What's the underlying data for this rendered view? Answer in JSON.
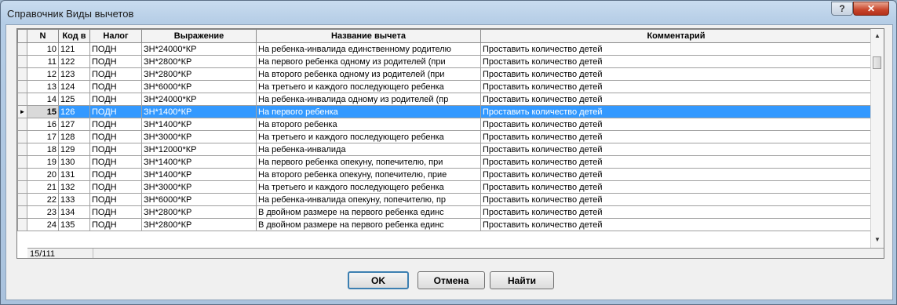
{
  "window": {
    "title": "Справочник Виды вычетов",
    "help_label": "?",
    "close_label": "✕"
  },
  "grid": {
    "columns": [
      "N",
      "Код в",
      "Налог",
      "Выражение",
      "Название вычета",
      "Комментарий"
    ],
    "rows": [
      {
        "n": "10",
        "code": "121",
        "tax": "ПОДН",
        "expr": "ЗН*24000*КР",
        "name": "На ребенка-инвалида единственному родителю",
        "comment": "Проставить количество детей"
      },
      {
        "n": "11",
        "code": "122",
        "tax": "ПОДН",
        "expr": "ЗН*2800*КР",
        "name": "На первого ребенка одному из родителей (при",
        "comment": "Проставить количество детей"
      },
      {
        "n": "12",
        "code": "123",
        "tax": "ПОДН",
        "expr": "ЗН*2800*КР",
        "name": "На второго ребенка одному из родителей (при",
        "comment": "Проставить количество детей"
      },
      {
        "n": "13",
        "code": "124",
        "tax": "ПОДН",
        "expr": "ЗН*6000*КР",
        "name": "На третьего и каждого последующего ребенка",
        "comment": "Проставить количество детей"
      },
      {
        "n": "14",
        "code": "125",
        "tax": "ПОДН",
        "expr": "ЗН*24000*КР",
        "name": "На ребенка-инвалида одному из родителей (пр",
        "comment": "Проставить количество детей"
      },
      {
        "n": "15",
        "code": "126",
        "tax": "ПОДН",
        "expr": "ЗН*1400*КР",
        "name": "На первого ребенка",
        "comment": "Проставить количество детей",
        "selected": true
      },
      {
        "n": "16",
        "code": "127",
        "tax": "ПОДН",
        "expr": "ЗН*1400*КР",
        "name": "На второго ребенка",
        "comment": "Проставить количество детей"
      },
      {
        "n": "17",
        "code": "128",
        "tax": "ПОДН",
        "expr": "ЗН*3000*КР",
        "name": "На третьего и каждого последующего ребенка",
        "comment": "Проставить количество детей"
      },
      {
        "n": "18",
        "code": "129",
        "tax": "ПОДН",
        "expr": "ЗН*12000*КР",
        "name": "На ребенка-инвалида",
        "comment": "Проставить количество детей"
      },
      {
        "n": "19",
        "code": "130",
        "tax": "ПОДН",
        "expr": "ЗН*1400*КР",
        "name": "На первого ребенка опекуну, попечителю, при",
        "comment": "Проставить количество детей"
      },
      {
        "n": "20",
        "code": "131",
        "tax": "ПОДН",
        "expr": "ЗН*1400*КР",
        "name": "На второго ребенка опекуну, попечителю, прие",
        "comment": "Проставить количество детей"
      },
      {
        "n": "21",
        "code": "132",
        "tax": "ПОДН",
        "expr": "ЗН*3000*КР",
        "name": "На третьего и каждого последующего ребенка",
        "comment": "Проставить количество детей"
      },
      {
        "n": "22",
        "code": "133",
        "tax": "ПОДН",
        "expr": "ЗН*6000*КР",
        "name": "На ребенка-инвалида опекуну, попечителю, пр",
        "comment": "Проставить количество детей"
      },
      {
        "n": "23",
        "code": "134",
        "tax": "ПОДН",
        "expr": "ЗН*2800*КР",
        "name": "В двойном размере на первого ребенка единс",
        "comment": "Проставить количество детей"
      },
      {
        "n": "24",
        "code": "135",
        "tax": "ПОДН",
        "expr": "ЗН*2800*КР",
        "name": "В двойном размере на первого ребенка единс",
        "comment": "Проставить количество детей"
      }
    ]
  },
  "status": {
    "position": "15/111"
  },
  "buttons": {
    "ok": "OK",
    "cancel": "Отмена",
    "find": "Найти"
  },
  "colors": {
    "selection": "#3399ff",
    "close_button": "#c8452b"
  }
}
